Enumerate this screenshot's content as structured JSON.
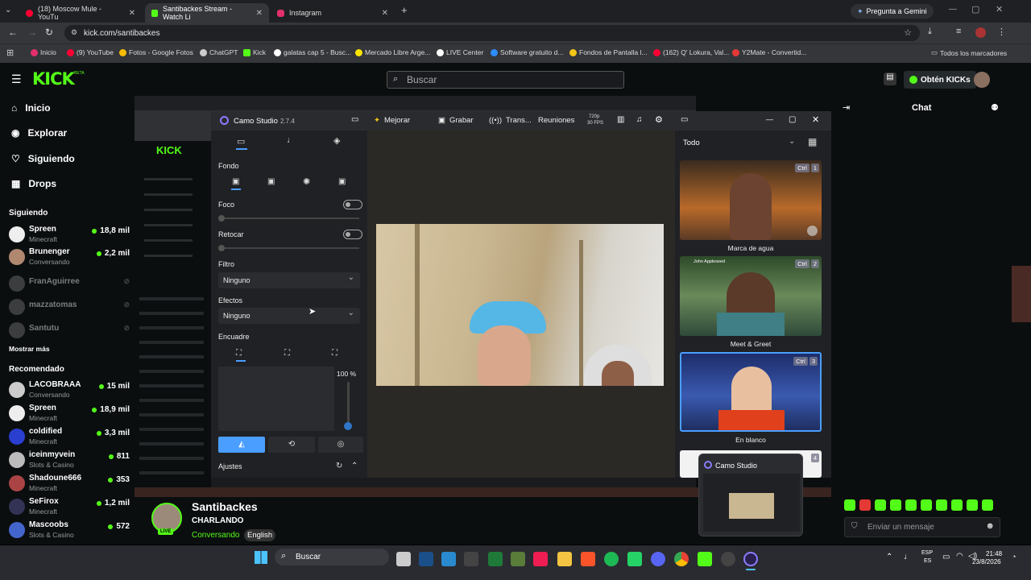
{
  "browser": {
    "tabs": [
      {
        "label": "(18) Moscow Mule - YouTu",
        "icon": "youtube-icon",
        "color": "#ff0033"
      },
      {
        "label": "Santibackes Stream - Watch Li",
        "icon": "kick-icon",
        "color": "#53fc18",
        "active": true
      },
      {
        "label": "Instagram",
        "icon": "instagram-icon",
        "color": "#e1306c"
      }
    ],
    "gemini": "Pregunta a Gemini",
    "url": "kick.com/santibackes",
    "bookmarks": [
      {
        "label": "Inicio",
        "color": "#e1306c"
      },
      {
        "label": "(9) YouTube",
        "color": "#ff0033"
      },
      {
        "label": "Fotos - Google Fotos",
        "color": "#fbbc04"
      },
      {
        "label": "ChatGPT",
        "color": "#cccccc"
      },
      {
        "label": "Kick",
        "color": "#53fc18"
      },
      {
        "label": "galatas cap 5 - Busc...",
        "color": "#ffffff"
      },
      {
        "label": "Mercado Libre Arge...",
        "color": "#ffe600"
      },
      {
        "label": "LIVE Center",
        "color": "#ffffff"
      },
      {
        "label": "Software gratuito d...",
        "color": "#2d8cff"
      },
      {
        "label": "Fondos de Pantalla l...",
        "color": "#f5c518"
      },
      {
        "label": "(162) Q' Lokura, Val...",
        "color": "#ff0033"
      },
      {
        "label": "Y2Mate - Convertid...",
        "color": "#e53935"
      }
    ],
    "all_bookmarks": "Todos los marcadores"
  },
  "kick": {
    "logo": "KICK",
    "beta": "BETA",
    "search_placeholder": "Buscar",
    "kicks_button": "Obtén KICKs",
    "chat_title": "Chat",
    "nav": [
      {
        "label": "Inicio",
        "icon": "home-icon"
      },
      {
        "label": "Explorar",
        "icon": "compass-icon"
      },
      {
        "label": "Siguiendo",
        "icon": "heart-icon"
      },
      {
        "label": "Drops",
        "icon": "drops-icon"
      }
    ],
    "following_title": "Siguiendo",
    "following": [
      {
        "name": "Spreen",
        "game": "Minecraft",
        "viewers": "18,8 mil",
        "online": true
      },
      {
        "name": "Brunenger",
        "game": "Conversando",
        "viewers": "2,2 mil",
        "online": true
      },
      {
        "name": "FranAguirree",
        "game": "",
        "viewers": "",
        "online": false
      },
      {
        "name": "mazzatomas",
        "game": "",
        "viewers": "",
        "online": false
      },
      {
        "name": "Santutu",
        "game": "",
        "viewers": "",
        "online": false
      }
    ],
    "show_more": "Mostrar más",
    "recommended_title": "Recomendado",
    "recommended": [
      {
        "name": "LACOBRAAA",
        "game": "Conversando",
        "viewers": "15 mil"
      },
      {
        "name": "Spreen",
        "game": "Minecraft",
        "viewers": "18,9 mil"
      },
      {
        "name": "coldified",
        "game": "Minecraft",
        "viewers": "3,3 mil"
      },
      {
        "name": "iceinmyvein",
        "game": "Slots & Casino",
        "viewers": "811"
      },
      {
        "name": "Shadoune666",
        "game": "Minecraft",
        "viewers": "353"
      },
      {
        "name": "SeFirox",
        "game": "Minecraft",
        "viewers": "1,2 mil"
      },
      {
        "name": "Mascoobs",
        "game": "Slots & Casino",
        "viewers": "572"
      }
    ],
    "streamer": {
      "name": "Santibackes",
      "title": "CHARLANDO",
      "category": "Conversando",
      "language": "English",
      "live": "LIVE"
    },
    "chat_placeholder": "Enviar un mensaje"
  },
  "camo": {
    "title": "Camo Studio",
    "version": "2.7.4",
    "toolbar": {
      "improve": "Mejorar",
      "record": "Grabar",
      "stream": "Trans...",
      "meetings": "Reuniones",
      "res": "720p",
      "fps": "30 FPS"
    },
    "background_label": "Fondo",
    "focus_label": "Foco",
    "retouch_label": "Retocar",
    "filter_label": "Filtro",
    "filter_value": "Ninguno",
    "effects_label": "Efectos",
    "effects_value": "Ninguno",
    "framing_label": "Encuadre",
    "zoom_value": "100 %",
    "settings_label": "Ajustes",
    "scene_filter": "Todo",
    "scenes": [
      {
        "caption": "Marca de agua",
        "ctrl": "Ctrl",
        "num": "1"
      },
      {
        "caption": "Meet & Greet",
        "ctrl": "Ctrl",
        "num": "2",
        "overlay_name": "John Appleseed"
      },
      {
        "caption": "En blanco",
        "ctrl": "Ctrl",
        "num": "3"
      },
      {
        "caption": "",
        "ctrl": "",
        "num": "4"
      }
    ],
    "popup_title": "Camo Studio"
  },
  "taskbar": {
    "search": "Buscar",
    "lang_top": "ESP",
    "lang_bottom": "ES",
    "time": "21:48",
    "date": "23/8/2026"
  }
}
